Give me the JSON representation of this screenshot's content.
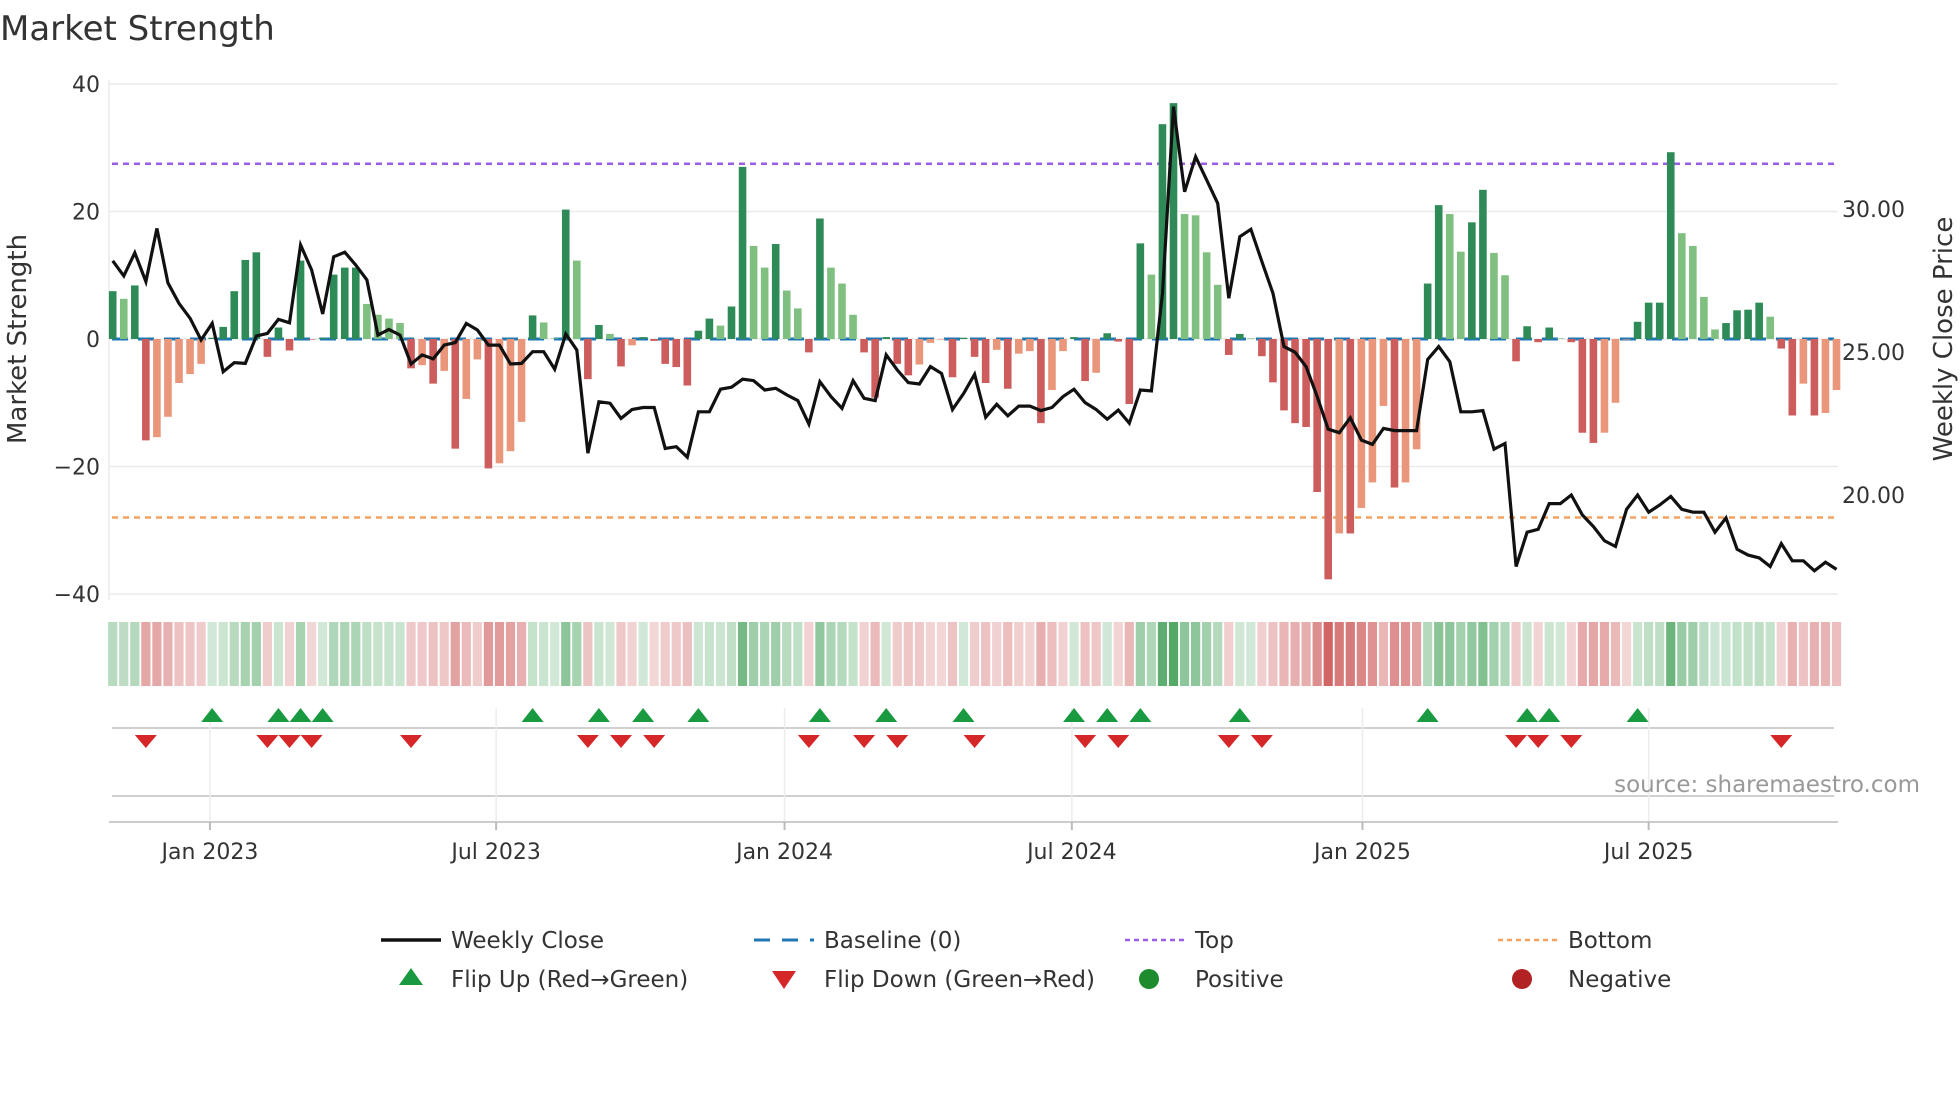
{
  "chart_data": {
    "type": "bar",
    "title": "Market Strength",
    "ylabel": "Market Strength",
    "ylabel_right": "Weekly Close Price",
    "ylim": [
      -40,
      40
    ],
    "ylim_right": [
      16.5,
      34.3
    ],
    "yticks": [
      {
        "v": 40,
        "label": "40"
      },
      {
        "v": 20,
        "label": "20"
      },
      {
        "v": 0,
        "label": "0"
      },
      {
        "v": -20,
        "label": "−20"
      },
      {
        "v": -40,
        "label": "−40"
      }
    ],
    "yticks_right": [
      {
        "v": 30,
        "label": "30.00"
      },
      {
        "v": 25,
        "label": "25.00"
      },
      {
        "v": 20,
        "label": "20.00"
      }
    ],
    "xticks": [
      {
        "week": 8.8,
        "label": "Jan 2023"
      },
      {
        "week": 34.7,
        "label": "Jul 2023"
      },
      {
        "week": 60.8,
        "label": "Jan 2024"
      },
      {
        "week": 86.8,
        "label": "Jul 2024"
      },
      {
        "week": 113.1,
        "label": "Jan 2025"
      },
      {
        "week": 139.0,
        "label": "Jul 2025"
      }
    ],
    "grid": true,
    "top_level": 27.5,
    "bottom_level": -28,
    "baseline": 0,
    "strength": [
      7.5,
      6.3,
      8.4,
      -15.9,
      -15.4,
      -12.2,
      -6.9,
      -5.5,
      -3.9,
      0.2,
      1.9,
      7.5,
      12.4,
      13.6,
      -2.8,
      1.8,
      -1.8,
      12.3,
      -0.1,
      0.2,
      10.1,
      11.2,
      11.2,
      5.5,
      3.8,
      3.2,
      2.5,
      -4.6,
      -4.1,
      -7,
      -5,
      -17.2,
      -9.4,
      -3.2,
      -20.3,
      -19.5,
      -17.6,
      -13,
      3.7,
      2.6,
      0.1,
      20.3,
      12.3,
      -6.3,
      2.2,
      0.8,
      -4.3,
      -1,
      0.3,
      -0.3,
      -3.9,
      -4.4,
      -7.3,
      1.3,
      3.2,
      2.1,
      5.1,
      27,
      14.6,
      11.2,
      14.9,
      7.6,
      4.8,
      -2.1,
      18.9,
      11.2,
      8.7,
      3.8,
      -2.1,
      -9.2,
      0.3,
      -3.9,
      -5.7,
      -4,
      -0.6,
      -0.1,
      -6,
      0.2,
      -2.8,
      -6.9,
      -1.7,
      -7.8,
      -2.3,
      -1.9,
      -13.2,
      -8,
      -1.9,
      0.3,
      -6.6,
      -5.3,
      0.9,
      -0.4,
      -10.2,
      15,
      10.1,
      33.7,
      37,
      19.6,
      19.4,
      13.6,
      8.5,
      -2.5,
      0.8,
      0.1,
      -2.7,
      -6.8,
      -11.2,
      -13.2,
      -13.8,
      -24,
      -37.7,
      -30.5,
      -30.5,
      -26.5,
      -22.5,
      -10.5,
      -23.3,
      -22.5,
      -17.3,
      8.7,
      21,
      19.6,
      13.7,
      18.3,
      23.4,
      13.5,
      10,
      -3.5,
      2,
      -0.5,
      1.8,
      0.1,
      -0.5,
      -14.7,
      -16.3,
      -14.7,
      -10,
      -0.1,
      2.7,
      5.7,
      5.7,
      29.3,
      16.6,
      14.6,
      6.6,
      1.5,
      2.5,
      4.5,
      4.6,
      5.7,
      3.5,
      -1.5,
      -12,
      -7,
      -12,
      -11.6,
      -8
    ],
    "weekly_close": [
      28.19,
      27.66,
      28.47,
      27.46,
      29.32,
      27.42,
      26.7,
      26.18,
      25.42,
      26.0,
      24.31,
      24.63,
      24.6,
      25.56,
      25.65,
      26.14,
      26.02,
      28.74,
      27.87,
      26.33,
      28.33,
      28.49,
      28.04,
      27.52,
      25.59,
      25.79,
      25.59,
      24.58,
      24.9,
      24.76,
      25.24,
      25.33,
      26.0,
      25.77,
      25.24,
      25.24,
      24.58,
      24.6,
      25.01,
      25.01,
      24.4,
      25.63,
      25.07,
      21.46,
      23.26,
      23.21,
      22.68,
      22.99,
      23.06,
      23.06,
      21.63,
      21.69,
      21.32,
      22.91,
      22.91,
      23.7,
      23.77,
      24.05,
      24.0,
      23.67,
      23.73,
      23.5,
      23.3,
      22.48,
      23.96,
      23.44,
      23.03,
      24.0,
      23.38,
      23.3,
      24.9,
      24.37,
      23.93,
      23.88,
      24.49,
      24.25,
      22.99,
      23.55,
      24.22,
      22.72,
      23.17,
      22.77,
      23.11,
      23.11,
      22.95,
      23.06,
      23.44,
      23.7,
      23.23,
      22.99,
      22.65,
      22.97,
      22.51,
      23.67,
      23.64,
      27.05,
      33.58,
      30.6,
      31.83,
      31.01,
      30.2,
      26.88,
      29.03,
      29.29,
      28.16,
      27.05,
      25.19,
      24.99,
      24.49,
      23.44,
      22.3,
      22.18,
      22.7,
      21.92,
      21.77,
      22.33,
      22.25,
      22.25,
      22.25,
      24.74,
      25.19,
      24.66,
      22.91,
      22.91,
      22.95,
      21.6,
      21.8,
      17.5,
      18.7,
      18.8,
      19.7,
      19.7,
      20.0,
      19.3,
      18.9,
      18.4,
      18.2,
      19.5,
      20.0,
      19.4,
      19.65,
      19.95,
      19.5,
      19.4,
      19.4,
      18.7,
      19.2,
      18.1,
      17.9,
      17.8,
      17.5,
      18.3,
      17.7,
      17.7,
      17.35,
      17.65,
      17.4
    ],
    "flip_up_weeks": [
      9,
      15,
      17,
      19,
      38,
      44,
      48,
      53,
      64,
      70,
      77,
      87,
      90,
      93,
      102,
      119,
      128,
      130,
      138
    ],
    "flip_down_weeks": [
      3,
      14,
      16,
      18,
      27,
      43,
      46,
      49,
      63,
      68,
      71,
      78,
      88,
      91,
      101,
      104,
      127,
      129,
      132,
      151
    ],
    "legend_placement": "bottom",
    "legend": [
      {
        "key": "weekly_close",
        "label": "Weekly Close"
      },
      {
        "key": "baseline",
        "label": "Baseline (0)"
      },
      {
        "key": "top",
        "label": "Top"
      },
      {
        "key": "bottom",
        "label": "Bottom"
      },
      {
        "key": "flip_up",
        "label": "Flip Up (Red→Green)"
      },
      {
        "key": "flip_down",
        "label": "Flip Down (Green→Red)"
      },
      {
        "key": "positive",
        "label": "Positive"
      },
      {
        "key": "negative",
        "label": "Negative"
      }
    ],
    "source_note": "source: sharemaestro.com"
  },
  "colors": {
    "pos_strong": "#2e8b57",
    "pos_weak": "#7fbf7f",
    "neg_strong": "#cd5c5c",
    "neg_weak": "#e9967a",
    "line": "#111111",
    "baseline": "#1f77b4",
    "top": "#9b5de5",
    "bottom": "#f4a261",
    "flip_up": "#1a9a40",
    "flip_down": "#d62728",
    "positive": "#1e8c2e",
    "negative": "#b22222"
  }
}
